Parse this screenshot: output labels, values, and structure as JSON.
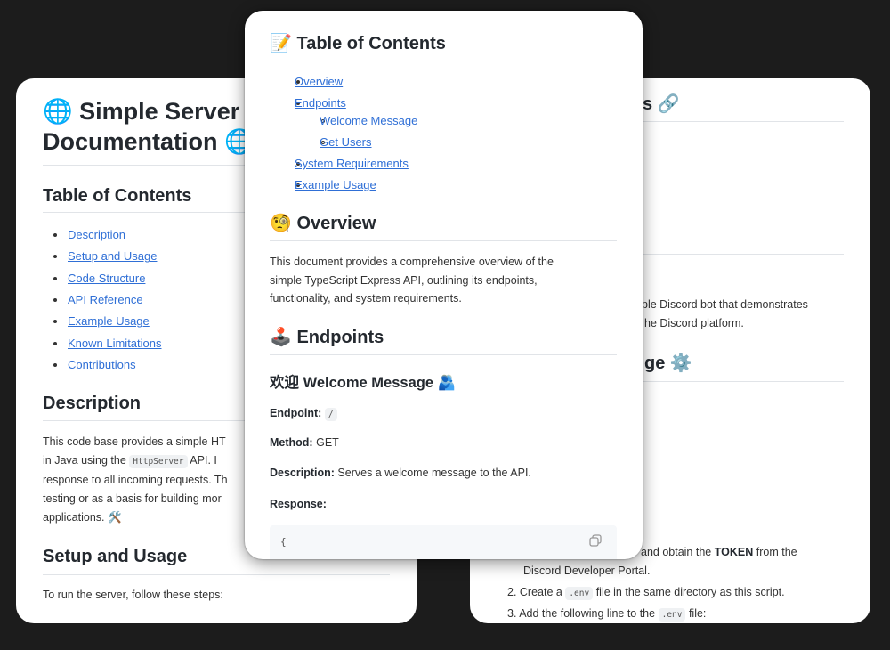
{
  "left_card": {
    "title_line1": "🌐 Simple Server",
    "title_line2": "Documentation 🌐",
    "toc_heading": "Table of Contents",
    "toc": [
      "Description",
      "Setup and Usage",
      "Code Structure",
      "API Reference",
      "Example Usage",
      "Known Limitations",
      "Contributions"
    ],
    "description_heading": "Description",
    "description_lines": [
      "This code base provides a simple HT",
      "in Java using the",
      "API. I",
      "response to all incoming requests. Th",
      "testing or as a basis for building mor",
      "applications. 🛠️"
    ],
    "description_code": "HttpServer",
    "setup_heading": "Setup and Usage",
    "setup_text": "To run the server, follow these steps:"
  },
  "middle_card": {
    "toc_heading": "📝 Table of Contents",
    "toc": [
      {
        "label": "Overview",
        "level": 1
      },
      {
        "label": "Endpoints",
        "level": 1
      },
      {
        "label": "Welcome Message",
        "level": 2
      },
      {
        "label": "Get Users",
        "level": 2
      },
      {
        "label": "System Requirements",
        "level": 1
      },
      {
        "label": "Example Usage",
        "level": 1
      }
    ],
    "overview_heading": "🧐 Overview",
    "overview_lines": [
      "This document provides a comprehensive overview of the",
      "simple TypeScript Express API, outlining its endpoints,",
      "functionality, and system requirements."
    ],
    "endpoints_heading": "🕹️ Endpoints",
    "welcome_heading": "欢迎 Welcome Message 🫂",
    "endpoint_label": "Endpoint:",
    "endpoint_value": "/",
    "method_label": "Method:",
    "method_value": "GET",
    "description_label": "Description:",
    "description_value": "Serves a welcome message to the API.",
    "response_label": "Response:",
    "code_first_line": "{",
    "copy_icon": "copy-icon"
  },
  "right_card": {
    "heading1_fragment": "s 🔗",
    "desc_line1": "ple Discord bot that demonstrates",
    "desc_line2": "he Discord platform.",
    "heading2_fragment": "ge ⚙️",
    "step1_a": "and obtain the",
    "step1_bold": "TOKEN",
    "step1_b": "from the",
    "step1_line2": "Discord Developer Portal.",
    "step2_a": "2. Create a",
    "step2_code": ".env",
    "step2_b": "file in the same directory as this script.",
    "step3_a": "3. Add the following line to the",
    "step3_code": ".env",
    "step3_b": "file:"
  }
}
